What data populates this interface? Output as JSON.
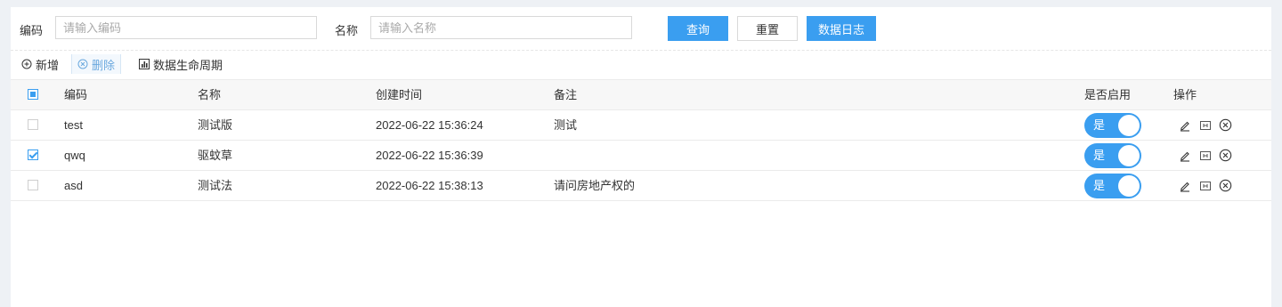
{
  "search": {
    "code_label": "编码",
    "code_placeholder": "请输入编码",
    "name_label": "名称",
    "name_placeholder": "请输入名称",
    "query_button": "查询",
    "reset_button": "重置",
    "log_button": "数据日志"
  },
  "toolbar": {
    "add_label": "新增",
    "delete_label": "删除",
    "lifecycle_label": "数据生命周期"
  },
  "table": {
    "headers": {
      "code": "编码",
      "name": "名称",
      "created": "创建时间",
      "remark": "备注",
      "enabled": "是否启用",
      "actions": "操作"
    },
    "header_checkbox_state": "partial",
    "rows": [
      {
        "checked": false,
        "code": "test",
        "name": "测试版",
        "created": "2022-06-22 15:36:24",
        "remark": "测试",
        "enabled_text": "是",
        "enabled": true
      },
      {
        "checked": true,
        "code": "qwq",
        "name": "驱蚊草",
        "created": "2022-06-22 15:36:39",
        "remark": "",
        "enabled_text": "是",
        "enabled": true
      },
      {
        "checked": false,
        "code": "asd",
        "name": "测试法",
        "created": "2022-06-22 15:38:13",
        "remark": "请问房地产权的",
        "enabled_text": "是",
        "enabled": true
      }
    ]
  },
  "colors": {
    "accent": "#3a9ef0",
    "background": "#eef1f5"
  }
}
